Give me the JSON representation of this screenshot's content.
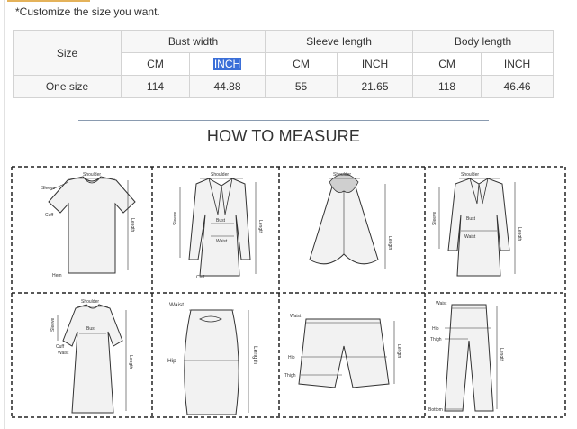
{
  "note": "*Customize the size you want.",
  "table": {
    "size_header": "Size",
    "groups": [
      "Bust width",
      "Sleeve length",
      "Body length"
    ],
    "units": [
      "CM",
      "INCH",
      "CM",
      "INCH",
      "CM",
      "INCH"
    ],
    "row_label": "One size",
    "values": [
      "114",
      "44.88",
      "55",
      "21.65",
      "118",
      "46.46"
    ]
  },
  "measure_title": "HOW TO MEASURE",
  "panels": {
    "tshirt": {
      "shoulder": "Shoulder",
      "sleeve": "Sleeve",
      "cuff": "Cuff",
      "hem": "Hem",
      "length": "Length"
    },
    "blazer": {
      "shoulder": "Shoulder",
      "sleeve": "Sleeve",
      "bust": "Bust",
      "waist": "Waist",
      "cuff": "Cuff",
      "length": "Length"
    },
    "cape": {
      "shoulder": "Shoulder",
      "length": "Length"
    },
    "coat": {
      "shoulder": "Shoulder",
      "sleeve": "Sleeve",
      "bust": "Bust",
      "waist": "Waist",
      "length": "Length"
    },
    "dress": {
      "shoulder": "Shoulder",
      "sleeve": "Sleeve",
      "bust": "Bust",
      "cuff": "Cuff",
      "waist": "Waist",
      "length": "Length"
    },
    "skirt": {
      "waist": "Waist",
      "hip": "Hip",
      "length": "Length"
    },
    "shorts": {
      "waist": "Waist",
      "hip": "Hip",
      "thigh": "Thigh",
      "length": "Length"
    },
    "pants": {
      "waist": "Waist",
      "hip": "Hip",
      "thigh": "Thigh",
      "bottom": "Bottom",
      "length": "Length"
    }
  }
}
